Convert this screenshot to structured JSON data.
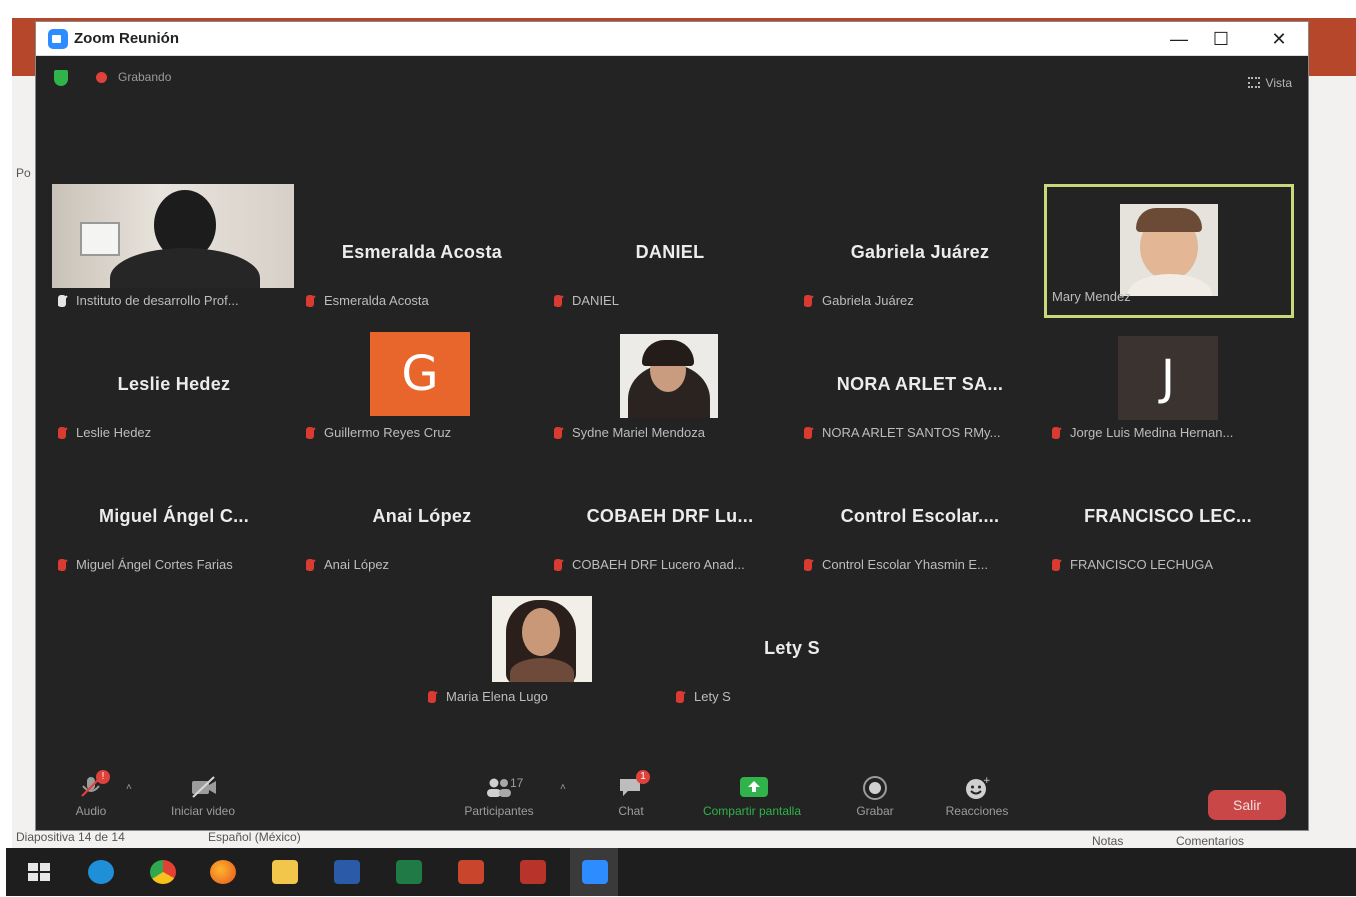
{
  "window": {
    "title": "Zoom Reunión"
  },
  "topbar": {
    "recording_label": "Grabando",
    "view_label": "Vista"
  },
  "ppt": {
    "side_label": "Po",
    "slide_status": "Diapositiva 14 de 14",
    "language": "Español (México)",
    "notes_label": "Notas",
    "comments_label": "Comentarios"
  },
  "participants": [
    {
      "display_name": "",
      "label": "Instituto de desarrollo Prof...",
      "video": "photo-office",
      "mic": "white"
    },
    {
      "display_name": "Esmeralda Acosta",
      "label": "Esmeralda Acosta",
      "mic": "muted"
    },
    {
      "display_name": "DANIEL",
      "label": "DANIEL",
      "mic": "muted"
    },
    {
      "display_name": "Gabriela Juárez",
      "label": "Gabriela Juárez",
      "mic": "muted"
    },
    {
      "display_name": "",
      "label": "Mary Mendez",
      "video": "photo-smile",
      "mic": "none",
      "active_speaker": true
    },
    {
      "display_name": "Leslie Hedez",
      "label": "Leslie Hedez",
      "mic": "muted"
    },
    {
      "display_name": "",
      "avatar_letter": "G",
      "avatar_color": "#e8662b",
      "label": "Guillermo Reyes Cruz",
      "mic": "muted"
    },
    {
      "display_name": "",
      "label": "Sydne Mariel Mendoza",
      "video": "photo-dark-hair",
      "mic": "muted"
    },
    {
      "display_name": "NORA ARLET SA...",
      "label": "NORA ARLET SANTOS RMy...",
      "mic": "muted"
    },
    {
      "display_name": "",
      "avatar_letter": "J",
      "avatar_color": "#3b3330",
      "label": "Jorge Luis Medina Hernan...",
      "mic": "muted"
    },
    {
      "display_name": "Miguel Ángel C...",
      "label": "Miguel Ángel Cortes Farias",
      "mic": "muted"
    },
    {
      "display_name": "Anai López",
      "label": "Anai López",
      "mic": "muted"
    },
    {
      "display_name": "COBAEH DRF Lu...",
      "label": "COBAEH DRF Lucero Anad...",
      "mic": "muted"
    },
    {
      "display_name": "Control  Escolar....",
      "label": "Control Escolar  Yhasmin E...",
      "mic": "muted"
    },
    {
      "display_name": "FRANCISCO  LEC...",
      "label": "FRANCISCO LECHUGA",
      "mic": "muted"
    },
    {
      "display_name": "",
      "label": "Maria Elena Lugo",
      "video": "photo-long-hair",
      "mic": "muted"
    },
    {
      "display_name": "Lety S",
      "label": "Lety S",
      "mic": "muted"
    }
  ],
  "toolbar": {
    "audio_label": "Audio",
    "video_label": "Iniciar video",
    "participants_label": "Participantes",
    "participants_count": "17",
    "chat_label": "Chat",
    "chat_badge": "1",
    "share_label": "Compartir pantalla",
    "record_label": "Grabar",
    "reactions_label": "Reacciones",
    "leave_label": "Salir"
  },
  "colors": {
    "share_green": "#2fb34a",
    "leave_red": "#c94747",
    "active_border": "#c9d97a",
    "window_bg": "#232323"
  }
}
